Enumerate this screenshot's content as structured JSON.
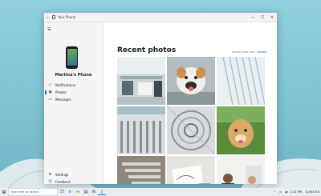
{
  "window": {
    "title": "Your Phone",
    "back_glyph": "←",
    "minimize_glyph": "—",
    "maximize_glyph": "☐",
    "close_glyph": "✕"
  },
  "sidebar": {
    "hamburger_glyph": "☰",
    "phone_name": "Martina's Phone",
    "items": [
      {
        "label": "Notifications",
        "icon": "bell-icon",
        "glyph": "○"
      },
      {
        "label": "Photos",
        "icon": "image-icon",
        "glyph": "▣"
      },
      {
        "label": "Messages",
        "icon": "chat-icon",
        "glyph": "▭"
      }
    ],
    "bottom_items": [
      {
        "label": "Settings",
        "icon": "gear-icon",
        "glyph": "⚙"
      },
      {
        "label": "Feedback",
        "icon": "feedback-icon",
        "glyph": "☺"
      }
    ]
  },
  "main": {
    "title": "Recent photos",
    "synced_text": "Synced just now",
    "refresh_label": "Update"
  },
  "photos": [
    {
      "name": "office-photo",
      "colors": [
        "#c9d3d8",
        "#7f8f96"
      ]
    },
    {
      "name": "dog-bulldog-photo",
      "colors": [
        "#b9c1c6",
        "#d9b58a"
      ]
    },
    {
      "name": "building-facade-photo",
      "colors": [
        "#e7edf1",
        "#a4b6c1"
      ]
    },
    {
      "name": "building-columns-photo",
      "colors": [
        "#b7c6cf",
        "#d8dde0"
      ]
    },
    {
      "name": "spiral-staircase-photo",
      "colors": [
        "#d7dbdd",
        "#8a8f92"
      ]
    },
    {
      "name": "dog-outdoor-photo",
      "colors": [
        "#e2c48c",
        "#4d7a36"
      ]
    },
    {
      "name": "staircase-photo",
      "colors": [
        "#8d877f",
        "#d6d3cc"
      ]
    },
    {
      "name": "desk-sketch-photo",
      "colors": [
        "#e6e6e3",
        "#9aa07c"
      ]
    },
    {
      "name": "people-meeting-photo",
      "colors": [
        "#f0f0ef",
        "#8a5b4a"
      ]
    }
  ],
  "taskbar": {
    "start_glyph": "⊞",
    "search_placeholder": "Type here to search",
    "apps": [
      {
        "name": "task-view-icon",
        "glyph": "❐"
      },
      {
        "name": "edge-icon",
        "glyph": "e"
      },
      {
        "name": "explorer-icon",
        "glyph": "▬"
      },
      {
        "name": "store-icon",
        "glyph": "▤"
      },
      {
        "name": "mail-icon",
        "glyph": "✉"
      },
      {
        "name": "your-phone-icon",
        "glyph": "▯"
      }
    ],
    "tray_items": [
      "^",
      "▭",
      "◀"
    ],
    "time": "2:21 PM",
    "date": "11/8/2018"
  }
}
